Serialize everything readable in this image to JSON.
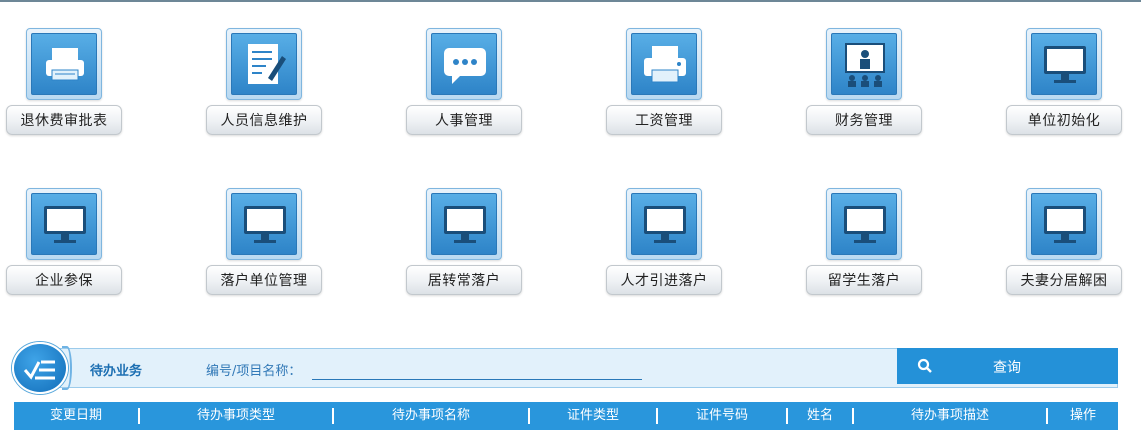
{
  "tiles": [
    {
      "label": "退休费审批表",
      "icon": "printer-icon"
    },
    {
      "label": "人员信息维护",
      "icon": "edit-document-icon"
    },
    {
      "label": "人事管理",
      "icon": "chat-bubble-icon"
    },
    {
      "label": "工资管理",
      "icon": "printer-icon"
    },
    {
      "label": "财务管理",
      "icon": "presentation-icon"
    },
    {
      "label": "单位初始化",
      "icon": "monitor-icon"
    },
    {
      "label": "企业参保",
      "icon": "monitor-icon"
    },
    {
      "label": "落户单位管理",
      "icon": "monitor-icon"
    },
    {
      "label": "居转常落户",
      "icon": "monitor-icon"
    },
    {
      "label": "人才引进落户",
      "icon": "monitor-icon"
    },
    {
      "label": "留学生落户",
      "icon": "monitor-icon"
    },
    {
      "label": "夫妻分居解困",
      "icon": "monitor-icon"
    }
  ],
  "search": {
    "section_title": "待办业务",
    "field_label": "编号/项目名称：",
    "value": "",
    "button_label": "查询",
    "button_icon": "search-icon"
  },
  "table": {
    "columns": [
      "变更日期",
      "待办事项类型",
      "待办事项名称",
      "证件类型",
      "证件号码",
      "姓名",
      "待办事项描述",
      "操作"
    ]
  },
  "colors": {
    "accent": "#2491d8",
    "header_bg": "#2996dc",
    "bar_bg": "#e2f1fb"
  }
}
